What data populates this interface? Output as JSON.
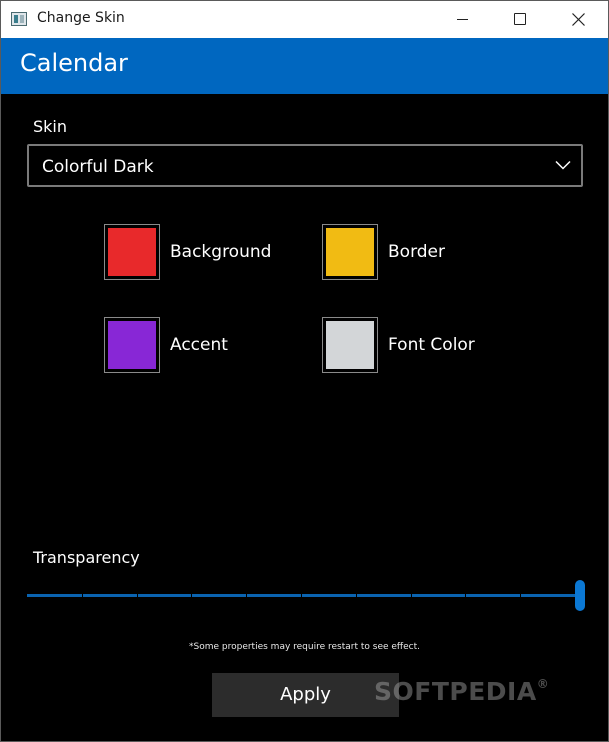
{
  "window": {
    "title": "Change Skin"
  },
  "header": {
    "title": "Calendar"
  },
  "skin": {
    "label": "Skin",
    "selected": "Colorful Dark"
  },
  "colors": {
    "background": {
      "label": "Background",
      "hex": "#e8292b"
    },
    "border": {
      "label": "Border",
      "hex": "#f1bb13"
    },
    "accent": {
      "label": "Accent",
      "hex": "#8827d6"
    },
    "font": {
      "label": "Font Color",
      "hex": "#d3d6d8"
    }
  },
  "transparency": {
    "label": "Transparency",
    "value_fraction": 1.0,
    "tick_count": 9
  },
  "note": "*Some properties may require restart to see effect.",
  "apply_label": "Apply",
  "watermark": {
    "text": "SOFTPEDIA",
    "reg": "®"
  }
}
